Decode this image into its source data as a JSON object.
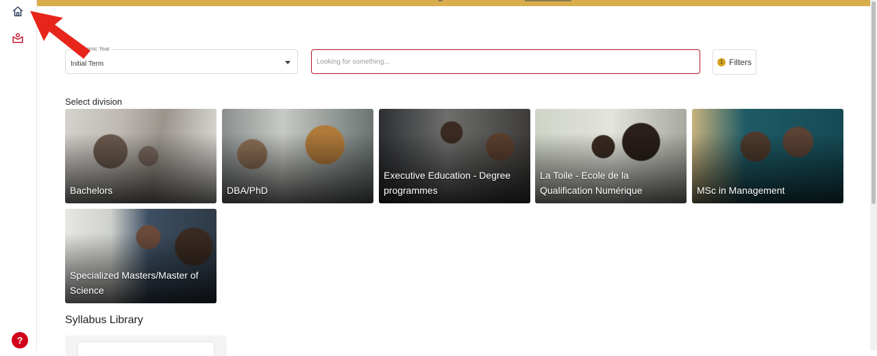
{
  "sidebar": {
    "icons": [
      "home-icon",
      "learning-icon"
    ],
    "help_label": "?"
  },
  "filters_bar": {
    "year_select": {
      "label": "Academic Year",
      "value": "Initial Term"
    },
    "search": {
      "placeholder": "Looking for something...",
      "value": ""
    },
    "filters_button": {
      "label": "Filters",
      "count": "1"
    }
  },
  "divisions": {
    "title": "Select division",
    "cards": [
      {
        "label": "Bachelors"
      },
      {
        "label": "DBA/PhD"
      },
      {
        "label": "Executive Education - Degree programmes"
      },
      {
        "label": "La Toile - Ecole de la Qualification Numérique"
      },
      {
        "label": "MSc in Management"
      },
      {
        "label": "Specialized Masters/Master of Science"
      }
    ]
  },
  "library": {
    "title": "Syllabus Library"
  },
  "colors": {
    "accent": "#b3101e",
    "banner": "#d8ad4c",
    "help": "#d0021b",
    "badge": "#d4a21f"
  }
}
